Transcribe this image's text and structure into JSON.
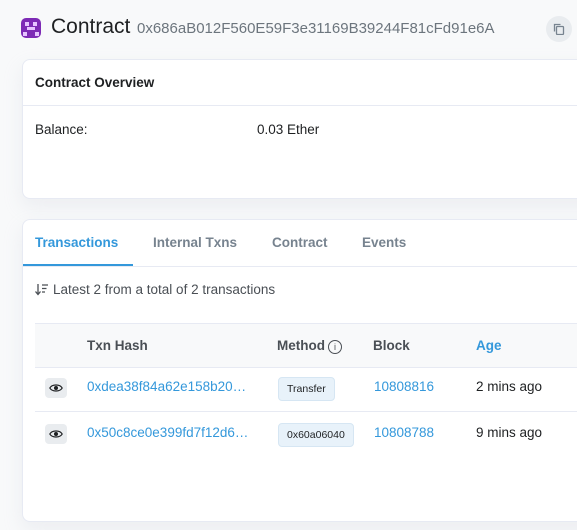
{
  "header": {
    "title": "Contract",
    "address": "0x686aB012F560E59F3e31169B39244F81cFd91e6A"
  },
  "overview": {
    "title": "Contract Overview",
    "balance_label": "Balance:",
    "balance_value": "0.03 Ether"
  },
  "tabs": [
    {
      "label": "Transactions",
      "active": true
    },
    {
      "label": "Internal Txns",
      "active": false
    },
    {
      "label": "Contract",
      "active": false
    },
    {
      "label": "Events",
      "active": false
    }
  ],
  "summary": "Latest 2 from a total of 2 transactions",
  "table": {
    "columns": [
      "Txn Hash",
      "Method",
      "Block",
      "Age"
    ],
    "rows": [
      {
        "hash": "0xdea38f84a62e158b20…",
        "method": "Transfer",
        "block": "10808816",
        "age": "2 mins ago"
      },
      {
        "hash": "0x50c8ce0e399fd7f12d6…",
        "method": "0x60a06040",
        "block": "10808788",
        "age": "9 mins ago"
      }
    ]
  },
  "colors": {
    "accent": "#3498db",
    "avatar": "#7d2ab5"
  }
}
